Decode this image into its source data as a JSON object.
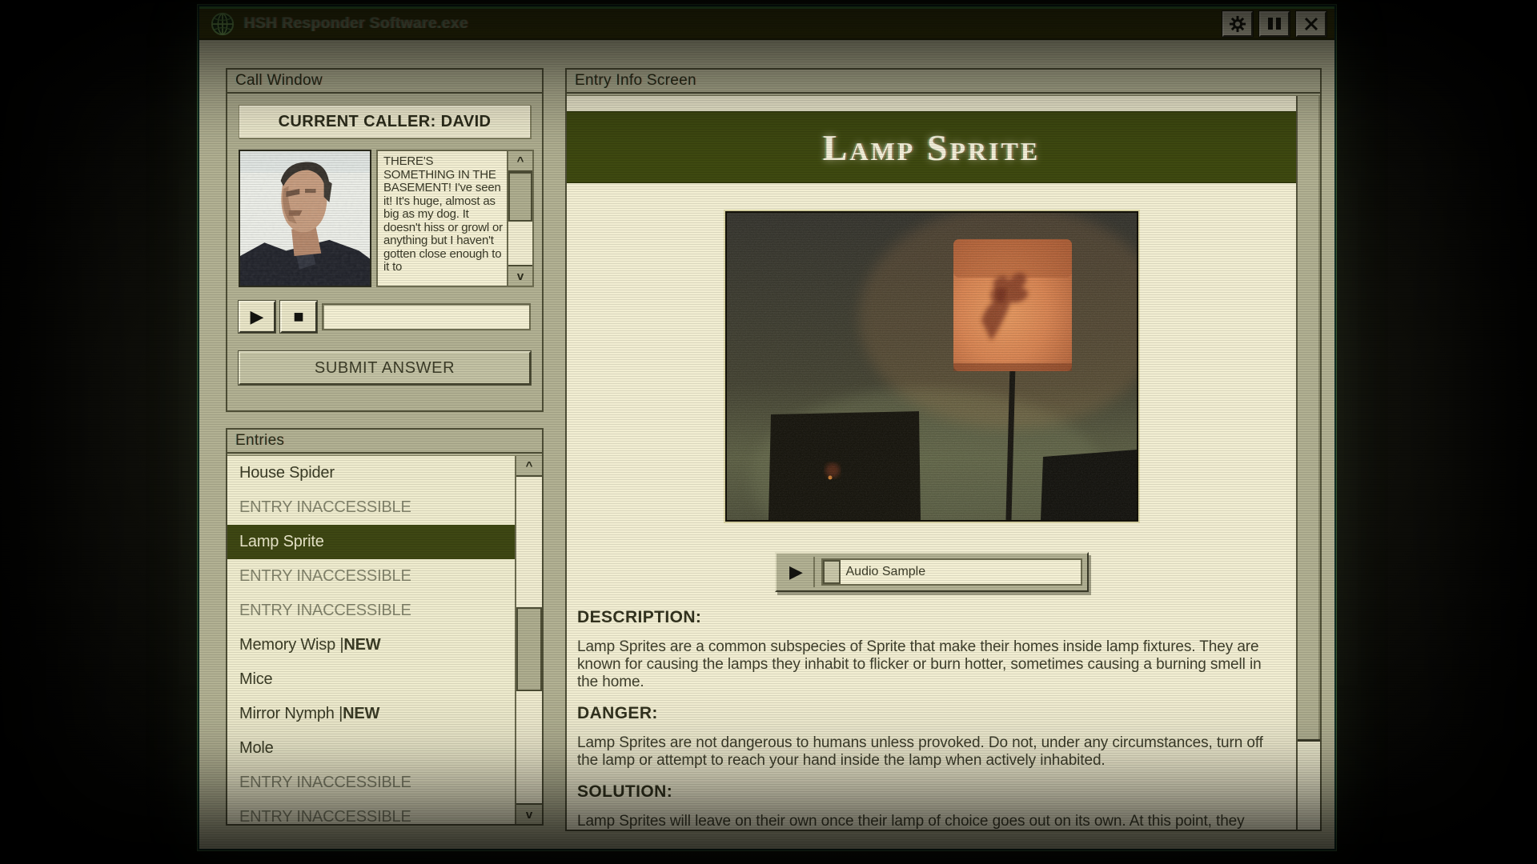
{
  "window": {
    "title": "HSH Responder Software.exe",
    "controls": {
      "settings": "settings",
      "pause": "pause",
      "close": "close"
    }
  },
  "call_window": {
    "title": "Call Window",
    "current_caller": "CURRENT CALLER: DAVID",
    "transcript": "THERE'S SOMETHING IN THE BASEMENT! I've seen it! It's huge, almost as big as my dog. It doesn't hiss or growl or anything but I haven't gotten close enough to it to",
    "play_glyph": "▶",
    "stop_glyph": "■",
    "submit_label": "SUBMIT ANSWER"
  },
  "entries": {
    "title": "Entries",
    "items": [
      {
        "label": "House Spider",
        "state": "normal"
      },
      {
        "label": "ENTRY INACCESSIBLE",
        "state": "inaccessible"
      },
      {
        "label": "Lamp Sprite",
        "state": "selected"
      },
      {
        "label": "ENTRY INACCESSIBLE",
        "state": "inaccessible"
      },
      {
        "label": "ENTRY INACCESSIBLE",
        "state": "inaccessible"
      },
      {
        "label": "Memory Wisp | ",
        "badge": "NEW",
        "state": "normal"
      },
      {
        "label": "Mice",
        "state": "normal"
      },
      {
        "label": "Mirror Nymph | ",
        "badge": "NEW",
        "state": "normal"
      },
      {
        "label": "Mole",
        "state": "normal"
      },
      {
        "label": "ENTRY INACCESSIBLE",
        "state": "inaccessible"
      },
      {
        "label": "ENTRY INACCESSIBLE",
        "state": "inaccessible"
      }
    ],
    "scroll_up_glyph": "^",
    "scroll_down_glyph": "v"
  },
  "entry_info": {
    "title": "Entry Info Screen",
    "entry_title": "Lamp Sprite",
    "image_alt": "lamp-sprite-photo",
    "audio": {
      "play_glyph": "▶",
      "label": "Audio Sample"
    },
    "sections": [
      {
        "heading": "DESCRIPTION:",
        "body": "Lamp Sprites are a common subspecies of Sprite that make their homes inside lamp fixtures. They are known for causing the lamps they inhabit to flicker or burn hotter, sometimes causing a burning smell in the home."
      },
      {
        "heading": "DANGER:",
        "body": "Lamp Sprites are not dangerous to humans unless provoked. Do not, under any circumstances, turn off the lamp or attempt to reach your hand inside the lamp when actively inhabited."
      },
      {
        "heading": "SOLUTION:",
        "body": "Lamp Sprites will leave on their own once their lamp of choice goes out on its own. At this point, they"
      }
    ]
  },
  "colors": {
    "window_face": "#b2b193",
    "content_cream": "#f2eed2",
    "titlebar_olive": "#33340b",
    "banner_green": "#3f4a11",
    "selected_green": "#3e4713",
    "lamp_glow_orange": "#d9824e",
    "text_dark": "#33331f"
  }
}
